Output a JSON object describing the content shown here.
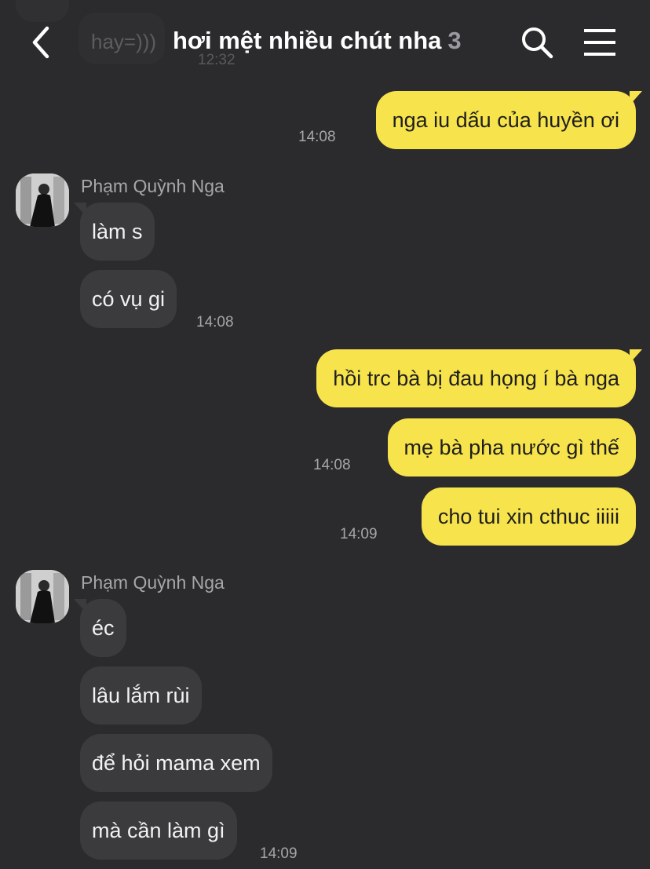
{
  "header": {
    "title": "hơi mệt nhiều chút nha",
    "member_count": "3",
    "back_icon": "chevron-left-icon",
    "search_icon": "search-icon",
    "menu_icon": "hamburger-menu-icon"
  },
  "ghost": {
    "text": "hay=)))",
    "time": "12:32"
  },
  "colors": {
    "background": "#2b2b2d",
    "outgoing_bubble": "#f7e34b",
    "incoming_bubble": "#3b3b3e",
    "secondary_text": "#a6a6aa"
  },
  "messages": {
    "m1": {
      "text": "nga iu dấu của huyền ơi",
      "time": "14:08"
    },
    "group1": {
      "sender": "Phạm Quỳnh Nga",
      "m1": "làm s",
      "m2": "có vụ gi",
      "time": "14:08"
    },
    "m2": {
      "text": "hồi trc bà bị đau họng í bà nga"
    },
    "m3": {
      "text": "mẹ bà pha nước gì thế",
      "time": "14:08"
    },
    "m4": {
      "text": "cho tui xin cthuc iiiii",
      "time": "14:09"
    },
    "group2": {
      "sender": "Phạm Quỳnh Nga",
      "m1": "éc",
      "m2": "lâu lắm rùi",
      "m3": "để hỏi mama xem",
      "m4": "mà cần làm gì",
      "time": "14:09"
    }
  }
}
